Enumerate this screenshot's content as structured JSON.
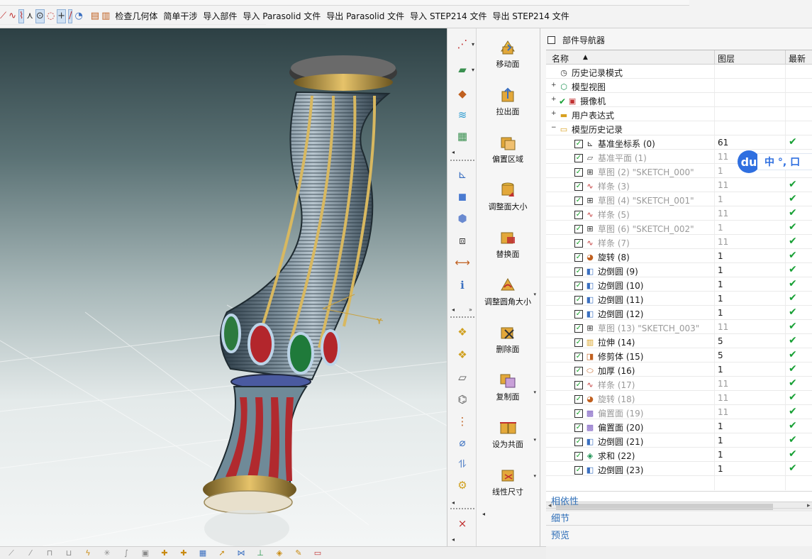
{
  "toolbar": {
    "commands": [
      "检查几何体",
      "简单干涉",
      "导入部件",
      "导入 Parasolid 文件",
      "导出 Parasolid 文件",
      "导入 STEP214 文件",
      "导出 STEP214 文件"
    ]
  },
  "commands": [
    {
      "label": "移动面",
      "icon": "move-face-icon"
    },
    {
      "label": "拉出面",
      "icon": "pull-face-icon"
    },
    {
      "label": "偏置区域",
      "icon": "offset-region-icon"
    },
    {
      "label": "调整面大小",
      "icon": "resize-face-icon"
    },
    {
      "label": "替换面",
      "icon": "replace-face-icon"
    },
    {
      "label": "调整圆角大小",
      "icon": "resize-blend-icon"
    },
    {
      "label": "删除面",
      "icon": "delete-face-icon"
    },
    {
      "label": "复制面",
      "icon": "copy-face-icon"
    },
    {
      "label": "设为共面",
      "icon": "make-coplanar-icon"
    },
    {
      "label": "线性尺寸",
      "icon": "linear-dimension-icon"
    }
  ],
  "navigator": {
    "title": "部件导航器",
    "columns": {
      "name": "名称",
      "layer": "图层",
      "latest": "最新"
    },
    "top_nodes": [
      {
        "label": "历史记录模式",
        "icon": "clock-icon"
      },
      {
        "label": "模型视图",
        "icon": "model-views-icon"
      },
      {
        "label": "摄像机",
        "icon": "camera-icon"
      },
      {
        "label": "用户表达式",
        "icon": "folder-icon"
      },
      {
        "label": "模型历史记录",
        "icon": "folder-open-icon"
      }
    ],
    "features": [
      {
        "name": "基准坐标系 (0)",
        "layer": "61",
        "latest": "✔",
        "dim": false,
        "icon": "datum-csys-icon"
      },
      {
        "name": "基准平面 (1)",
        "layer": "11",
        "latest": "",
        "dim": true,
        "icon": "datum-plane-icon"
      },
      {
        "name": "草图 (2) \"SKETCH_000\"",
        "layer": "1",
        "latest": "",
        "dim": true,
        "icon": "sketch-icon"
      },
      {
        "name": "样条 (3)",
        "layer": "11",
        "latest": "✔",
        "dim": true,
        "icon": "spline-icon"
      },
      {
        "name": "草图 (4) \"SKETCH_001\"",
        "layer": "1",
        "latest": "✔",
        "dim": true,
        "icon": "sketch-icon"
      },
      {
        "name": "样条 (5)",
        "layer": "11",
        "latest": "✔",
        "dim": true,
        "icon": "spline-icon"
      },
      {
        "name": "草图 (6) \"SKETCH_002\"",
        "layer": "1",
        "latest": "✔",
        "dim": true,
        "icon": "sketch-icon"
      },
      {
        "name": "样条 (7)",
        "layer": "11",
        "latest": "✔",
        "dim": true,
        "icon": "spline-icon"
      },
      {
        "name": "旋转 (8)",
        "layer": "1",
        "latest": "✔",
        "dim": false,
        "icon": "revolve-icon"
      },
      {
        "name": "边倒圆 (9)",
        "layer": "1",
        "latest": "✔",
        "dim": false,
        "icon": "edge-blend-icon"
      },
      {
        "name": "边倒圆 (10)",
        "layer": "1",
        "latest": "✔",
        "dim": false,
        "icon": "edge-blend-icon"
      },
      {
        "name": "边倒圆 (11)",
        "layer": "1",
        "latest": "✔",
        "dim": false,
        "icon": "edge-blend-icon"
      },
      {
        "name": "边倒圆 (12)",
        "layer": "1",
        "latest": "✔",
        "dim": false,
        "icon": "edge-blend-icon"
      },
      {
        "name": "草图 (13) \"SKETCH_003\"",
        "layer": "11",
        "latest": "✔",
        "dim": true,
        "icon": "sketch-icon"
      },
      {
        "name": "拉伸 (14)",
        "layer": "5",
        "latest": "✔",
        "dim": false,
        "icon": "extrude-icon"
      },
      {
        "name": "修剪体 (15)",
        "layer": "5",
        "latest": "✔",
        "dim": false,
        "icon": "trim-body-icon"
      },
      {
        "name": "加厚 (16)",
        "layer": "1",
        "latest": "✔",
        "dim": false,
        "icon": "thicken-icon"
      },
      {
        "name": "样条 (17)",
        "layer": "11",
        "latest": "✔",
        "dim": true,
        "icon": "spline-icon"
      },
      {
        "name": "旋转 (18)",
        "layer": "11",
        "latest": "✔",
        "dim": true,
        "icon": "revolve-icon"
      },
      {
        "name": "偏置面 (19)",
        "layer": "11",
        "latest": "✔",
        "dim": true,
        "icon": "offset-face-icon"
      },
      {
        "name": "偏置面 (20)",
        "layer": "1",
        "latest": "✔",
        "dim": false,
        "icon": "offset-face-icon"
      },
      {
        "name": "边倒圆 (21)",
        "layer": "1",
        "latest": "✔",
        "dim": false,
        "icon": "edge-blend-icon"
      },
      {
        "name": "求和 (22)",
        "layer": "1",
        "latest": "✔",
        "dim": false,
        "icon": "unite-icon"
      },
      {
        "name": "边倒圆 (23)",
        "layer": "1",
        "latest": "✔",
        "dim": false,
        "icon": "edge-blend-icon"
      }
    ],
    "panels": [
      "相依性",
      "细节",
      "预览"
    ]
  },
  "ime": {
    "logo": "du",
    "text": "中 °, 口"
  },
  "colors": {
    "accent": "#2f6fb8",
    "check": "#18a035",
    "dim_text": "#9a9a9a"
  }
}
